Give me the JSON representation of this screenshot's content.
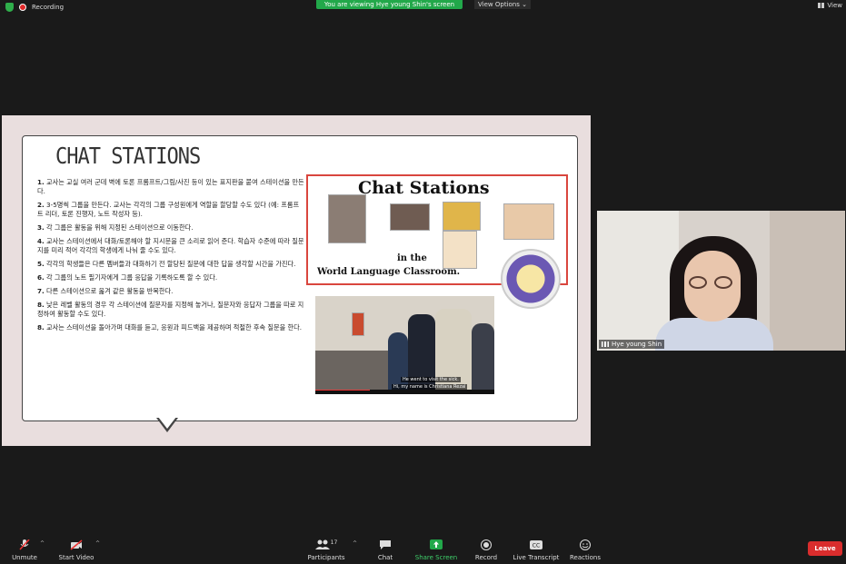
{
  "top": {
    "recording": "Recording",
    "viewing_banner": "You are viewing Hye young Shin's screen",
    "view_options": "View Options ⌄",
    "view": "View"
  },
  "slide": {
    "title": "CHAT STATIONS",
    "items": [
      {
        "num": "1.",
        "text": "교사는 교실 여러 군데 벽에 토론 프롬프트/그림/사진 등이 있는 표지판을 붙여 스테이션을 만든다."
      },
      {
        "num": "2.",
        "text": "3-5명씩 그룹을 만든다. 교사는 각각의 그룹 구성원에게 역할을 할당할 수도 있다 (예: 프롬프트 리더, 토론 진행자, 노트 작성자 등)."
      },
      {
        "num": "3.",
        "text": "각 그룹은 활동을 위해 지정된 스테이션으로 이동한다."
      },
      {
        "num": "4.",
        "text": "교사는 스테이션에서 대화/토론해야 할 지시문을 큰 소리로 읽어 준다. 학습자 수준에 따라 질문지를 미리 적어 각각의 학생에게 나눠 줄 수도 있다."
      },
      {
        "num": "5.",
        "text": "각각의 학생들은 다른 멤버들과 대화하기 전 할당된 질문에 대한 답을 생각할 시간을 가진다."
      },
      {
        "num": "6.",
        "text": "각 그룹의 노트 필기자에게 그룹 응답을 기록하도록 할 수 있다."
      },
      {
        "num": "7.",
        "text": "다른 스테이션으로 옮겨 같은 활동을 반복한다."
      },
      {
        "num": "8.",
        "text": "낮은 레벨 활동의 경우 각 스테이션에 질문자를 지정해 놓거나, 질문자와 응답자 그룹을 따로 지정하여 활동할 수도 있다."
      },
      {
        "num": "8.",
        "text": "교사는 스테이션을 돌아가며 대화를 듣고, 응원과 피드백을 제공하며 적절한 후속 질문을 한다."
      }
    ],
    "cs_title": "Chat Stations",
    "cs_in": "in the",
    "cs_world": "World Language Classroom.",
    "video_caption1": "He went to visit the sick.",
    "video_caption2": "Hi, my name is Christiana Rezai",
    "video_link": "http://www.youtube.com/watch?v=..."
  },
  "camera": {
    "name": "Hye young Shin"
  },
  "toolbar": {
    "unmute": "Unmute",
    "start_video": "Start Video",
    "participants": "Participants",
    "participants_count": "17",
    "chat": "Chat",
    "share_screen": "Share Screen",
    "record": "Record",
    "live_transcript": "Live Transcript",
    "reactions": "Reactions",
    "leave": "Leave"
  },
  "colors": {
    "share_green": "#22a84a",
    "leave_red": "#d92d2d",
    "rec_red": "#e02828"
  }
}
